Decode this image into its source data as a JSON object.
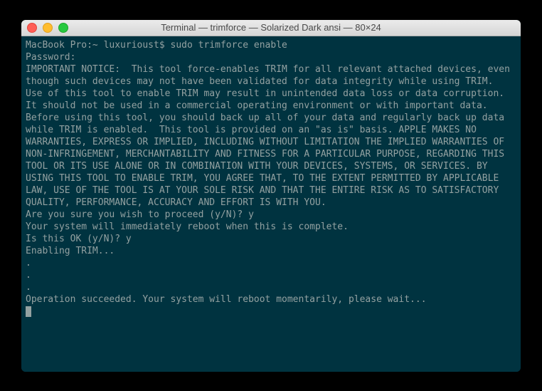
{
  "window": {
    "title": "Terminal — trimforce — Solarized Dark ansi — 80×24"
  },
  "prompt": {
    "host_path": "MacBook Pro:~ luxurioust$ ",
    "command": "sudo trimforce enable"
  },
  "lines": {
    "password": "Password:",
    "notice": "IMPORTANT NOTICE:  This tool force-enables TRIM for all relevant attached devices, even though such devices may not have been validated for data integrity while using TRIM.  Use of this tool to enable TRIM may result in unintended data loss or data corruption.  It should not be used in a commercial operating environment or with important data. Before using this tool, you should back up all of your data and regularly back up data while TRIM is enabled.  This tool is provided on an \"as is\" basis. APPLE MAKES NO WARRANTIES, EXPRESS OR IMPLIED, INCLUDING WITHOUT LIMITATION THE IMPLIED WARRANTIES OF NON-INFRINGEMENT, MERCHANTABILITY AND FITNESS FOR A PARTICULAR PURPOSE, REGARDING THIS TOOL OR ITS USE ALONE OR IN COMBINATION WITH YOUR DEVICES, SYSTEMS, OR SERVICES. BY USING THIS TOOL TO ENABLE TRIM, YOU AGREE THAT, TO THE EXTENT PERMITTED BY APPLICABLE LAW, USE OF THE TOOL IS AT YOUR SOLE RISK AND THAT THE ENTIRE RISK AS TO SATISFACTORY QUALITY, PERFORMANCE, ACCURACY AND EFFORT IS WITH YOU.",
    "proceed": "Are you sure you wish to proceed (y/N)? y",
    "reboot_msg": "Your system will immediately reboot when this is complete.",
    "ok_prompt": "Is this OK (y/N)? y",
    "enabling": "Enabling TRIM...",
    "dot1": ".",
    "dot2": ".",
    "dot3": ".",
    "succeeded": "Operation succeeded. Your system will reboot momentarily, please wait..."
  },
  "colors": {
    "bg": "#003340",
    "fg": "#93a1a1"
  }
}
